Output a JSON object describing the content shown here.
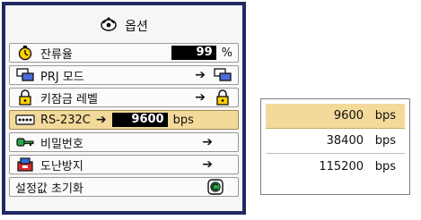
{
  "menu": {
    "title": "옵션",
    "rows": [
      {
        "label": "잔류율",
        "value": "99",
        "unit": "%"
      },
      {
        "label": "PRJ 모드"
      },
      {
        "label": "키잠금 레벨"
      },
      {
        "label": "RS-232C",
        "value": "9600",
        "unit": "bps"
      },
      {
        "label": "비밀번호"
      },
      {
        "label": "도난방지"
      },
      {
        "label": "설정값 초기화"
      }
    ]
  },
  "dropdown": {
    "options": [
      {
        "value": "9600",
        "unit": "bps"
      },
      {
        "value": "38400",
        "unit": "bps"
      },
      {
        "value": "115200",
        "unit": "bps"
      }
    ],
    "selected_index": 0
  },
  "icons": [
    "settings-icon",
    "timer-icon",
    "prj-mode-icon",
    "lock-icon",
    "rs232c-icon",
    "key-icon",
    "anti-theft-icon",
    "reset-icon"
  ],
  "colors": {
    "frame": "#1f2a63",
    "highlight": "#f3d99a",
    "value_box": "#000000"
  }
}
